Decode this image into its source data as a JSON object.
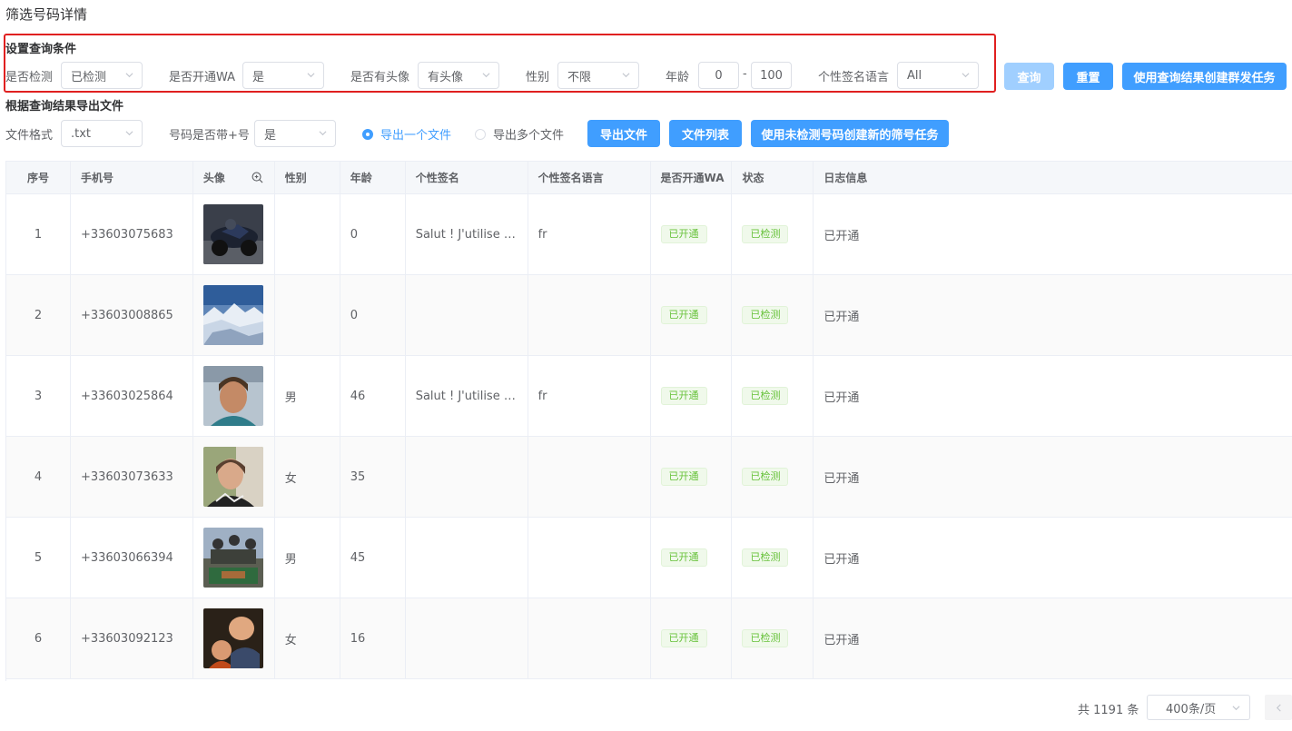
{
  "page_title": "筛选号码详情",
  "query": {
    "section_title": "设置查询条件",
    "detected_label": "是否检测",
    "detected_value": "已检测",
    "wa_label": "是否开通WA",
    "wa_value": "是",
    "avatar_label": "是否有头像",
    "avatar_value": "有头像",
    "gender_label": "性别",
    "gender_value": "不限",
    "age_label": "年龄",
    "age_min": "0",
    "age_sep": "-",
    "age_max": "100",
    "sig_lang_label": "个性签名语言",
    "sig_lang_value": "All",
    "query_button": "查询",
    "reset_button": "重置",
    "create_group_button": "使用查询结果创建群发任务"
  },
  "export": {
    "section_title": "根据查询结果导出文件",
    "format_label": "文件格式",
    "format_value": ".txt",
    "plus_label": "号码是否带+号",
    "plus_value": "是",
    "radio_one": "导出一个文件",
    "radio_many": "导出多个文件",
    "export_button": "导出文件",
    "file_list_button": "文件列表",
    "create_filter_button": "使用未检测号码创建新的筛号任务"
  },
  "table": {
    "headers": [
      "序号",
      "手机号",
      "头像",
      "性别",
      "年龄",
      "个性签名",
      "个性签名语言",
      "是否开通WA",
      "状态",
      "日志信息"
    ],
    "rows": [
      {
        "no": "1",
        "phone": "+33603075683",
        "gender": "",
        "age": "0",
        "signature": "Salut ! J'utilise WhatsApp.",
        "lang": "fr",
        "wa": "已开通",
        "status": "已检测",
        "log": "已开通"
      },
      {
        "no": "2",
        "phone": "+33603008865",
        "gender": "",
        "age": "0",
        "signature": "",
        "lang": "",
        "wa": "已开通",
        "status": "已检测",
        "log": "已开通"
      },
      {
        "no": "3",
        "phone": "+33603025864",
        "gender": "男",
        "age": "46",
        "signature": "Salut ! J'utilise WhatsApp.",
        "lang": "fr",
        "wa": "已开通",
        "status": "已检测",
        "log": "已开通"
      },
      {
        "no": "4",
        "phone": "+33603073633",
        "gender": "女",
        "age": "35",
        "signature": "",
        "lang": "",
        "wa": "已开通",
        "status": "已检测",
        "log": "已开通"
      },
      {
        "no": "5",
        "phone": "+33603066394",
        "gender": "男",
        "age": "45",
        "signature": "",
        "lang": "",
        "wa": "已开通",
        "status": "已检测",
        "log": "已开通"
      },
      {
        "no": "6",
        "phone": "+33603092123",
        "gender": "女",
        "age": "16",
        "signature": "",
        "lang": "",
        "wa": "已开通",
        "status": "已检测",
        "log": "已开通"
      }
    ]
  },
  "pagination": {
    "total": "共 1191 条",
    "page_size": "400条/页",
    "prev_icon": "chevron-left-icon"
  },
  "colors": {
    "primary": "#409eff",
    "primary_disabled": "#a0cfff",
    "highlight_border": "#e02020",
    "tag_success": "#67c23a"
  }
}
